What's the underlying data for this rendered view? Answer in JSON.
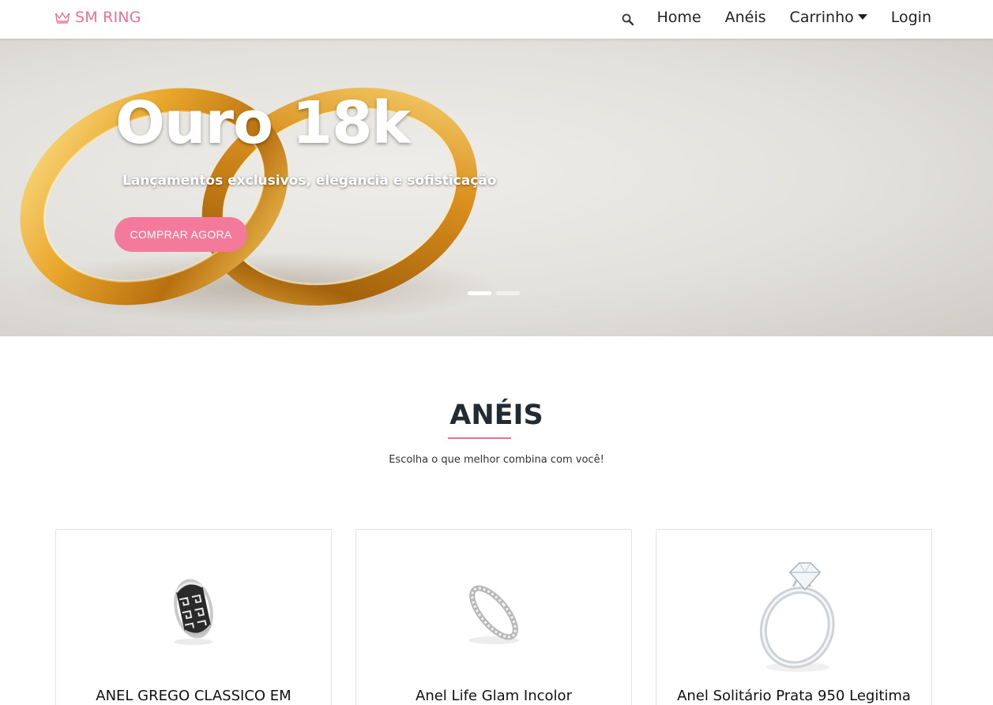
{
  "brand": {
    "name": "SM RING",
    "icon": "crown-icon",
    "color": "#f06f96"
  },
  "nav": {
    "search_icon": "search-icon",
    "links": [
      {
        "label": "Home"
      },
      {
        "label": "Anéis"
      },
      {
        "label": "Carrinho",
        "has_dropdown": true
      },
      {
        "label": "Login"
      }
    ]
  },
  "hero": {
    "title": "Ouro 18k",
    "subtitle": "Lançamentos exclusivos, elegancia e sofisticação",
    "button_label": "COMPRAR AGORA",
    "button_color": "#f47a9c",
    "indicators": [
      {
        "active": true
      },
      {
        "active": false
      }
    ]
  },
  "section": {
    "title": "ANÉIS",
    "subtitle": "Escolha o que melhor combina com você!"
  },
  "products": [
    {
      "title": "ANEL GREGO CLASSICO EM",
      "image": "greek-pattern-ring"
    },
    {
      "title": "Anel Life Glam Incolor",
      "image": "eternity-band-ring"
    },
    {
      "title": "Anel Solitário Prata 950 Legitima",
      "image": "solitaire-diamond-ring"
    }
  ]
}
